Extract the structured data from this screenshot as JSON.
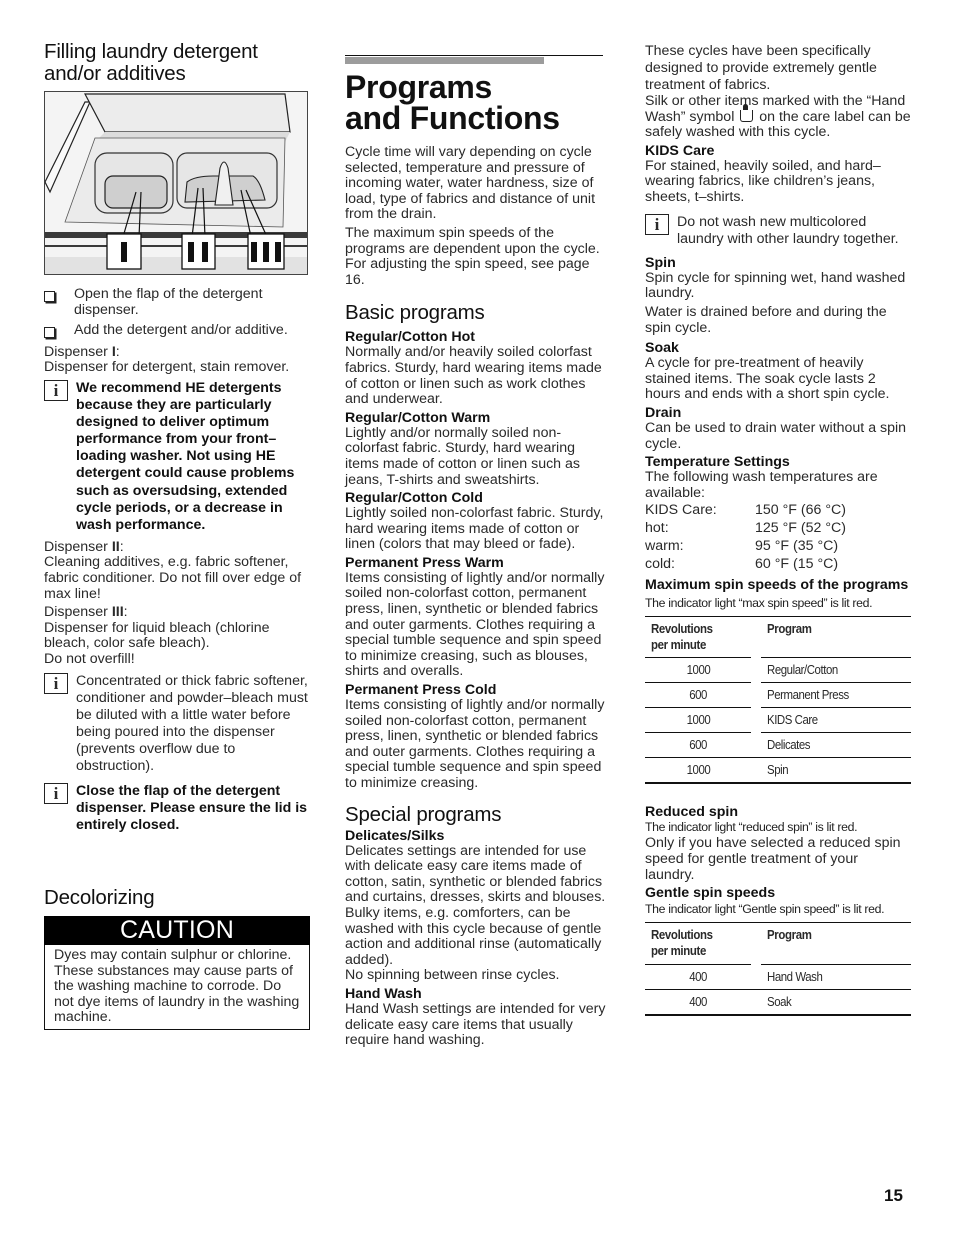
{
  "page_number": "15",
  "left_column": {
    "heading": "Filling laundry detergent and/or additives",
    "illustration": {
      "description": "detergent-dispenser-illustration",
      "labels": [
        "I",
        "II",
        "III"
      ]
    },
    "steps": [
      "Open the flap of the detergent dispenser.",
      "Add the detergent and/or additive."
    ],
    "dispenser_1": {
      "label_prefix": "Dispenser ",
      "label_num": "I",
      "label_suffix": ":",
      "text": "Dispenser for detergent, stain remover."
    },
    "note_he": "We recommend HE detergents because they are particularly designed to deliver optimum performance from your front–loading washer.  Not using HE detergent could cause problems such as oversudsing, extended cycle periods, or a decrease in wash performance.",
    "dispenser_2": {
      "label_prefix": "Dispenser ",
      "label_num": "II",
      "label_suffix": ":",
      "text": "Cleaning additives, e.g. fabric softener, fabric conditioner. Do not fill over edge of max line!"
    },
    "dispenser_3": {
      "label_prefix": "Dispenser ",
      "label_num": "III",
      "label_suffix": ":",
      "text": "Dispenser for liquid bleach (chlorine bleach, color safe bleach).",
      "text2": "Do not overfill!"
    },
    "note_concentrated": "Concentrated or thick fabric softener, conditioner and powder–bleach must be diluted with a little water before being poured into the dispenser (prevents overflow due to obstruction).",
    "note_close": "Close the flap of the detergent dispenser.  Please ensure the lid is entirely closed.",
    "decolorizing_heading": "Decolorizing",
    "caution_label": "CAUTION",
    "caution_text": "Dyes may contain sulphur or chlorine. These substances may cause parts of the washing machine to corrode. Do not dye items of laundry in the washing machine."
  },
  "middle_column": {
    "title_line1": "Programs",
    "title_line2": "and Functions",
    "intro_1": "Cycle time will vary depending on cycle selected, temperature and pressure of incoming water, water hardness, size of load, type of fabrics and distance of unit from the drain.",
    "intro_2": "The maximum spin speeds of the programs are dependent upon the cycle. For adjusting the spin speed, see page 16.",
    "basic_heading": "Basic programs",
    "basic_programs": [
      {
        "name": "Regular/Cotton Hot",
        "text": "Normally and/or heavily soiled colorfast fabrics. Sturdy, hard wearing items made of cotton or linen such as work clothes and underwear."
      },
      {
        "name": "Regular/Cotton Warm",
        "text": "Lightly and/or normally soiled non-colorfast fabric. Sturdy, hard wearing items made of cotton or linen such as jeans, T-shirts and sweatshirts."
      },
      {
        "name": "Regular/Cotton Cold",
        "text": "Lightly soiled non-colorfast fabric. Sturdy, hard wearing items made of cotton or linen (colors that may bleed or fade)."
      },
      {
        "name": "Permanent Press Warm",
        "text": "Items consisting of lightly and/or normally soiled non-colorfast cotton, permanent press, linen, synthetic or blended fabrics and outer garments. Clothes requiring a special tumble sequence and spin speed to minimize creasing, such as blouses, shirts and overalls."
      },
      {
        "name": "Permanent Press Cold",
        "text": "Items consisting of lightly and/or normally soiled non-colorfast cotton, permanent press, linen, synthetic or blended fabrics and outer garments. Clothes requiring a special tumble sequence and spin speed to minimize creasing."
      }
    ],
    "special_heading": "Special programs",
    "delicates": {
      "name": "Delicates/Silks",
      "text1": "Delicates settings are intended for use with delicate easy care items made of cotton, satin, synthetic or blended fabrics and curtains, dresses, skirts and blouses.",
      "text2": "Bulky items, e.g. comforters, can be washed with this cycle because of gentle action and additional rinse (automatically added).",
      "text3": "No spinning between rinse cycles."
    },
    "hand_wash": {
      "name": "Hand Wash",
      "text": "Hand Wash settings are intended for very delicate easy care items that usually require hand washing."
    }
  },
  "right_column": {
    "hand_wash_cont_1": "These cycles have been specifically designed to provide extremely gentle treatment of fabrics.",
    "hand_wash_cont_2a": "Silk or other items marked with the “Hand Wash” symbol",
    "hand_wash_cont_2b": "on the care label can be safely washed with this cycle.",
    "kids_care": {
      "name": "KIDS Care",
      "text": "For stained, heavily soiled, and hard–wearing fabrics, like children’s jeans, sheets, t–shirts.",
      "note": "Do not wash new multicolored laundry with other laundry together."
    },
    "spin": {
      "name": "Spin",
      "text1": "Spin cycle for spinning wet, hand washed laundry.",
      "text2": "Water is drained before and during the spin cycle."
    },
    "soak": {
      "name": "Soak",
      "text": "A cycle for pre-treatment of heavily stained items. The soak cycle lasts 2 hours and ends with a short spin cycle."
    },
    "drain": {
      "name": "Drain",
      "text": "Can be used to drain water without a spin cycle."
    },
    "temperature": {
      "name": "Temperature Settings",
      "intro": "The following wash temperatures are available:",
      "rows": [
        {
          "label": "KIDS Care:",
          "value": "150 °F (66 °C)"
        },
        {
          "label": "hot:",
          "value": "125 °F (52 °C)"
        },
        {
          "label": "warm:",
          "value": "95 °F (35 °C)"
        },
        {
          "label": "cold:",
          "value": "60 °F (15 °C)"
        }
      ]
    },
    "max_spin": {
      "name": "Maximum spin speeds of the programs",
      "indicator": "The indicator light “max spin speed” is lit red.",
      "col_rpm": "Revolutions per minute",
      "col_rpm_1": "Revolutions",
      "col_rpm_2": "per minute",
      "col_program": "Program",
      "rows": [
        {
          "rpm": "1000",
          "program": "Regular/Cotton"
        },
        {
          "rpm": "600",
          "program": "Permanent Press"
        },
        {
          "rpm": "1000",
          "program": "KIDS Care"
        },
        {
          "rpm": "600",
          "program": "Delicates"
        },
        {
          "rpm": "1000",
          "program": "Spin"
        }
      ]
    },
    "reduced_spin": {
      "name": "Reduced spin",
      "indicator": "The indicator light “reduced spin” is lit red.",
      "text": "Only if you have selected a reduced spin speed for gentle treatment of your laundry."
    },
    "gentle_spin": {
      "name": "Gentle spin speeds",
      "indicator": "The indicator light “Gentle spin speed” is lit red.",
      "col_rpm_1": "Revolutions",
      "col_rpm_2": "per minute",
      "col_program": "Program",
      "rows": [
        {
          "rpm": "400",
          "program": "Hand Wash"
        },
        {
          "rpm": "400",
          "program": "Soak"
        }
      ]
    }
  }
}
